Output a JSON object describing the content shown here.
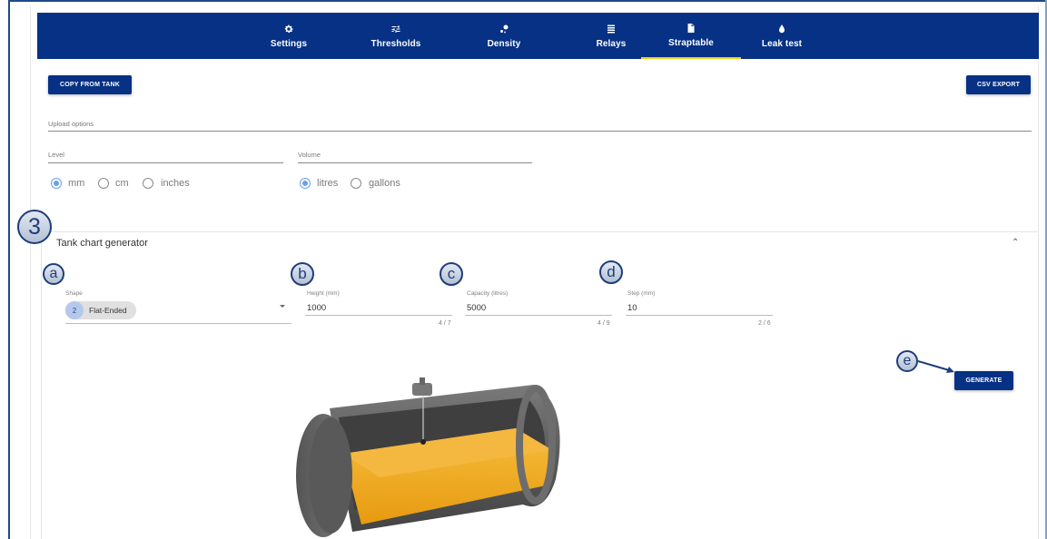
{
  "tabs": [
    {
      "label": "Settings",
      "icon": "gear-icon"
    },
    {
      "label": "Thresholds",
      "icon": "sliders-icon"
    },
    {
      "label": "Density",
      "icon": "drops-icon"
    },
    {
      "label": "Relays",
      "icon": "relays-icon"
    },
    {
      "label": "Straptable",
      "icon": "document-icon",
      "active": true
    },
    {
      "label": "Leak test",
      "icon": "drop-icon"
    }
  ],
  "toolbar": {
    "copy_label": "COPY FROM TANK",
    "export_label": "CSV EXPORT"
  },
  "upload": {
    "title": "Upload options",
    "level_label": "Level",
    "volume_label": "Volume",
    "level_options": [
      "mm",
      "cm",
      "inches"
    ],
    "level_selected": "mm",
    "volume_options": [
      "litres",
      "gallons"
    ],
    "volume_selected": "litres"
  },
  "steps": {
    "main": "3",
    "a": "a",
    "b": "b",
    "c": "c",
    "d": "d",
    "e": "e"
  },
  "generator": {
    "title": "Tank chart generator",
    "shape_label": "Shape",
    "shape_number": "2",
    "shape_value": "Flat-Ended",
    "height_label": "Height (mm)",
    "height_value": "1000",
    "height_counter": "4 / 7",
    "capacity_label": "Capacity (litres)",
    "capacity_value": "5000",
    "capacity_counter": "4 / 9",
    "step_label": "Step (mm)",
    "step_value": "10",
    "step_counter": "2 / 6",
    "generate_label": "GENERATE",
    "fill_level": 0.55
  },
  "colors": {
    "brand": "#063184",
    "tab_active_underline": "#f2d21f",
    "radio_selected": "#6aa0e6",
    "tank_fill": "#f0a818",
    "tank_shell": "#666666"
  }
}
